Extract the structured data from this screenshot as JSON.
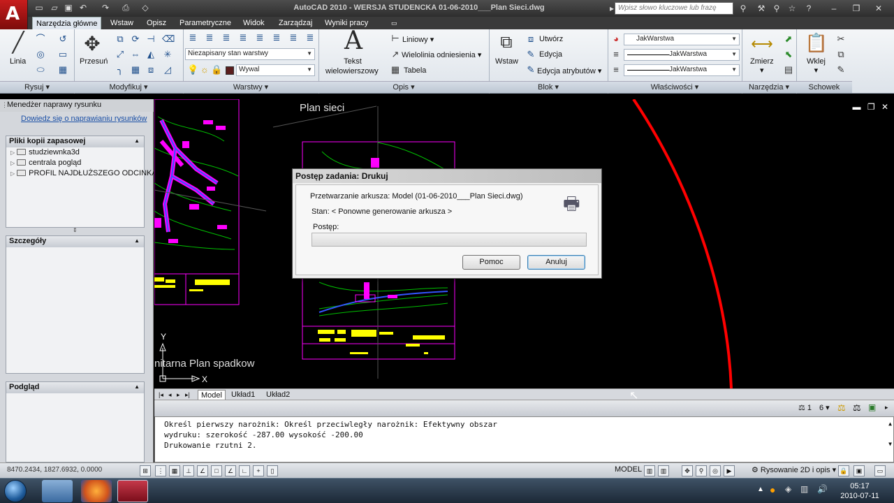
{
  "window": {
    "title": "AutoCAD 2010 - WERSJA STUDENCKA          01-06-2010___Plan Sieci.dwg",
    "search_placeholder": "Wpisz słowo kluczowe lub frazę"
  },
  "ribbon": {
    "tabs": [
      "Narzędzia główne",
      "Wstaw",
      "Opisz",
      "Parametryczne",
      "Widok",
      "Zarządzaj",
      "Wyniki pracy"
    ],
    "active_tab": "Narzędzia główne",
    "draw": {
      "line_label": "Linia",
      "panel_label": "Rysuj"
    },
    "modify": {
      "move_label": "Przesuń",
      "panel_label": "Modyfikuj"
    },
    "layers": {
      "state_combo": "Niezapisany stan warstwy",
      "layer_combo": "Wywal",
      "panel_label": "Warstwy"
    },
    "annotation": {
      "text_label_1": "Tekst",
      "text_label_2": "wielowierszowy",
      "linear_label": "Liniowy",
      "multileader_label": "Wielolinia odniesienia",
      "table_label": "Tabela",
      "panel_label": "Opis"
    },
    "block": {
      "insert_label": "Wstaw",
      "create_label": "Utwórz",
      "edit_label": "Edycja",
      "edit_attr_label": "Edycja atrybutów",
      "panel_label": "Blok"
    },
    "properties": {
      "color_combo": "JakWarstwa",
      "linetype_combo": "JakWarstwa",
      "lineweight_combo": "JakWarstwa",
      "panel_label": "Właściwości"
    },
    "utilities": {
      "measure_label": "Zmierz",
      "panel_label": "Narzędzia"
    },
    "clipboard": {
      "paste_label": "Wklej",
      "panel_label": "Schowek"
    }
  },
  "palette": {
    "title": "Menedżer naprawy rysunku",
    "link": "Dowiedz się o naprawianiu rysunków",
    "backups_header": "Pliki kopii zapasowej",
    "backup_files": [
      "studziewnka3d",
      "centrala pogląd",
      "PROFIL NAJDŁUŻSZEGO ODCINKA"
    ],
    "details_header": "Szczegóły",
    "preview_header": "Podgląd"
  },
  "drawing": {
    "plan_title": "Plan sieci",
    "plan_label_2": "nitarna Plan spadkow",
    "axis_y": "Y",
    "axis_x": "X",
    "colors": {
      "magenta": "#ff00ff",
      "yellow": "#ffff00",
      "red": "#ff0000",
      "green": "#00ff00",
      "blue": "#4040ff"
    }
  },
  "layout_tabs": [
    "Model",
    "Układ1",
    "Układ2"
  ],
  "command_line": [
    "Określ pierwszy narożnik: Określ przeciwległy narożnik: Efektywny obszar",
    "wydruku: szerokość -287.00 wysokość -200.00",
    "Drukowanie rzutni 2."
  ],
  "status_bar": {
    "coords": "8470.2434, 1827.6932, 0.0000",
    "model_label": "MODEL",
    "workspace": "Rysowanie 2D i opis",
    "annotation_scale": "1",
    "annotation_count": "6"
  },
  "taskbar": {
    "time": "05:17",
    "date": "2010-07-11"
  },
  "dialog": {
    "title": "Postęp zadania: Drukuj",
    "processing": "Przetwarzanie arkusza: Model (01-06-2010___Plan Sieci.dwg)",
    "status": "Stan: < Ponowne generowanie arkusza >",
    "progress_label": "Postęp:",
    "progress_fraction": 0.0,
    "help_button": "Pomoc",
    "cancel_button": "Anuluj"
  }
}
